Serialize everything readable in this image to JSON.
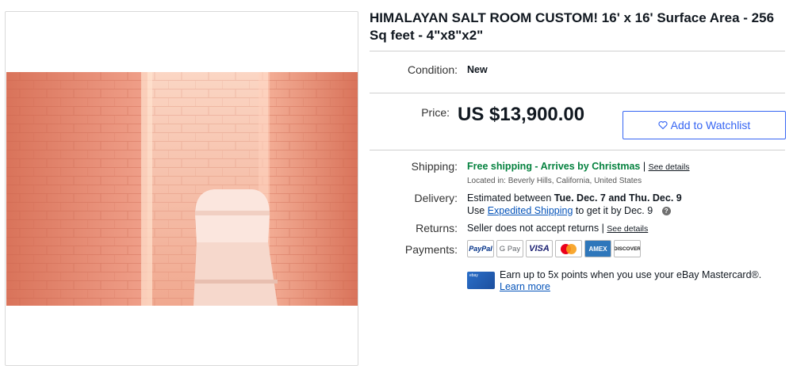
{
  "listing": {
    "title": "HIMALAYAN SALT ROOM CUSTOM! 16' x 16' Surface Area - 256 Sq feet - 4\"x8\"x2\""
  },
  "condition": {
    "label": "Condition:",
    "value": "New"
  },
  "price": {
    "label": "Price:",
    "value": "US $13,900.00"
  },
  "watchlist": {
    "label": "Add to Watchlist"
  },
  "shipping": {
    "label": "Shipping:",
    "free_text": "Free shipping - Arrives by Christmas",
    "separator": "|",
    "see_details": "See details",
    "location": "Located in:  Beverly Hills, California, United States"
  },
  "delivery": {
    "label": "Delivery:",
    "estimate_prefix": "Estimated between ",
    "estimate_dates": "Tue. Dec. 7 and Thu. Dec. 9",
    "use_prefix": "Use ",
    "expedited_link": "Expedited Shipping",
    "use_suffix": " to get it by Dec. 9",
    "help": "?"
  },
  "returns": {
    "label": "Returns:",
    "value": "Seller does not accept returns",
    "separator": "|",
    "see_details": "See details"
  },
  "payments": {
    "label": "Payments:",
    "methods": [
      "PayPal",
      "G Pay",
      "VISA",
      "Mastercard",
      "AMEX",
      "DISCOVER"
    ]
  },
  "mastercard_promo": {
    "text": "Earn up to 5x points when you use your eBay Mastercard®.",
    "link": "Learn more",
    "card_label": "ebay"
  },
  "colors": {
    "accent_blue": "#3665f3",
    "link_blue": "#0654ba",
    "free_shipping_green": "#05823f"
  }
}
